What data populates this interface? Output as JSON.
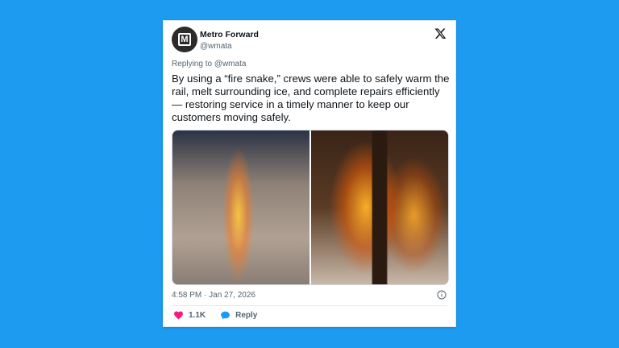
{
  "account": {
    "name": "Metro Forward",
    "handle": "@wmata",
    "avatar_letter": "M"
  },
  "reply_context": {
    "prefix": "Replying to ",
    "handle": "@wmata"
  },
  "tweet": {
    "text": "By using a “fire snake,” crews were able to safely warm the rail, melt surrounding ice, and complete repairs efficiently — restoring service in a timely manner to keep our customers moving safely."
  },
  "timestamp": "4:58 PM · Jan 27, 2026",
  "actions": {
    "like_count": "1.1K",
    "reply_label": "Reply"
  },
  "icons": {
    "logo": "x-logo-icon",
    "like": "heart-icon",
    "reply": "speech-bubble-icon",
    "info": "info-icon"
  },
  "colors": {
    "background": "#1d9bf0",
    "heart": "#f91880",
    "reply_bubble": "#1d9bf0",
    "text_primary": "#0f1419",
    "text_secondary": "#536471"
  }
}
